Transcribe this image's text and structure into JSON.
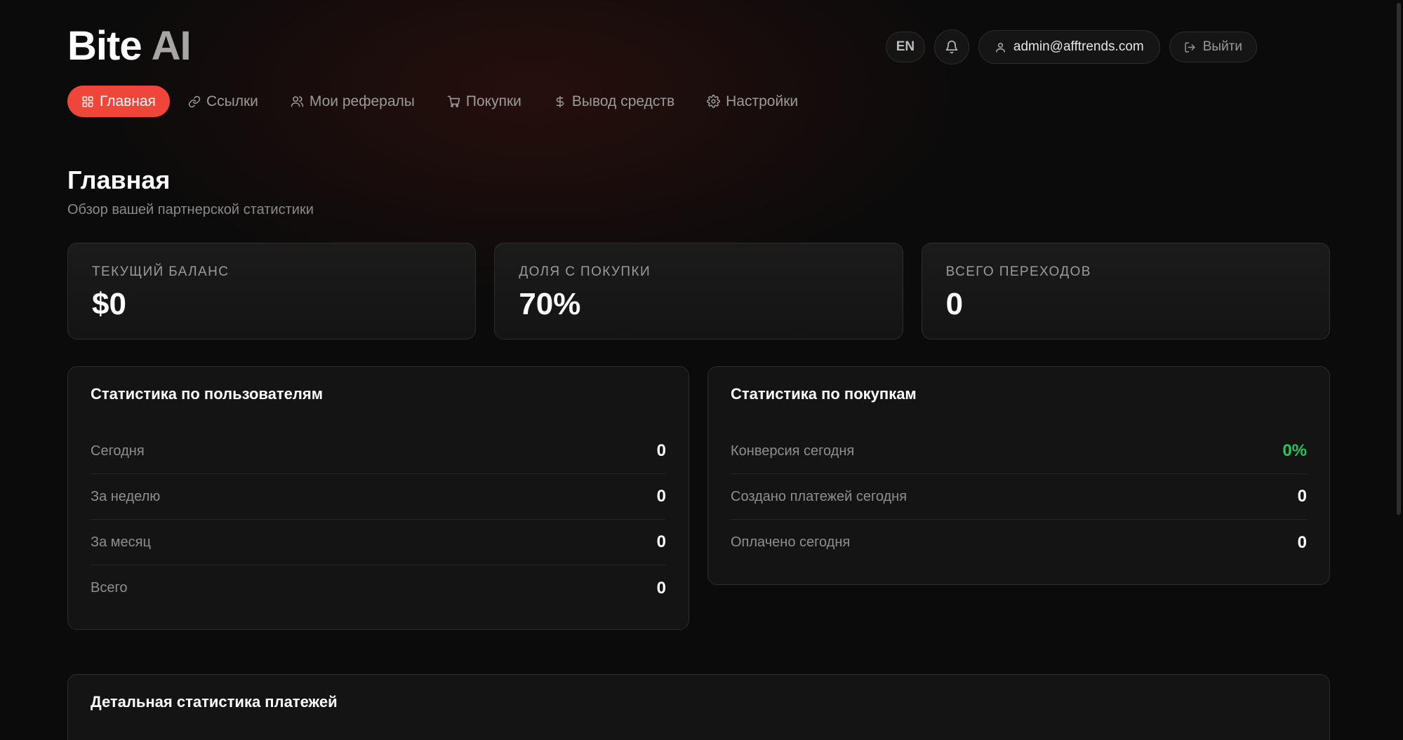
{
  "header": {
    "logo_main": "Bite",
    "logo_accent": "AI",
    "lang_label": "EN",
    "user_email": "admin@afftrends.com",
    "logout_label": "Выйти"
  },
  "nav": {
    "items": [
      {
        "label": "Главная",
        "icon": "grid-icon",
        "active": true
      },
      {
        "label": "Ссылки",
        "icon": "link-icon",
        "active": false
      },
      {
        "label": "Мои рефералы",
        "icon": "users-icon",
        "active": false
      },
      {
        "label": "Покупки",
        "icon": "cart-icon",
        "active": false
      },
      {
        "label": "Вывод средств",
        "icon": "dollar-icon",
        "active": false
      },
      {
        "label": "Настройки",
        "icon": "gear-icon",
        "active": false
      }
    ]
  },
  "page": {
    "title": "Главная",
    "subtitle": "Обзор вашей партнерской статистики"
  },
  "kpis": [
    {
      "label": "ТЕКУЩИЙ БАЛАНС",
      "value": "$0"
    },
    {
      "label": "ДОЛЯ С ПОКУПКИ",
      "value": "70%"
    },
    {
      "label": "ВСЕГО ПЕРЕХОДОВ",
      "value": "0"
    }
  ],
  "user_stats": {
    "title": "Статистика по пользователям",
    "rows": [
      {
        "label": "Сегодня",
        "value": "0"
      },
      {
        "label": "За неделю",
        "value": "0"
      },
      {
        "label": "За месяц",
        "value": "0"
      },
      {
        "label": "Всего",
        "value": "0"
      }
    ]
  },
  "purchase_stats": {
    "title": "Статистика по покупкам",
    "rows": [
      {
        "label": "Конверсия сегодня",
        "value": "0%"
      },
      {
        "label": "Создано платежей сегодня",
        "value": "0"
      },
      {
        "label": "Оплачено сегодня",
        "value": "0"
      }
    ]
  },
  "payment_details": {
    "title": "Детальная статистика платежей"
  },
  "colors": {
    "accent": "#ef4639",
    "positive": "#22c55e",
    "background": "#0b0b0b",
    "card": "#141414"
  }
}
